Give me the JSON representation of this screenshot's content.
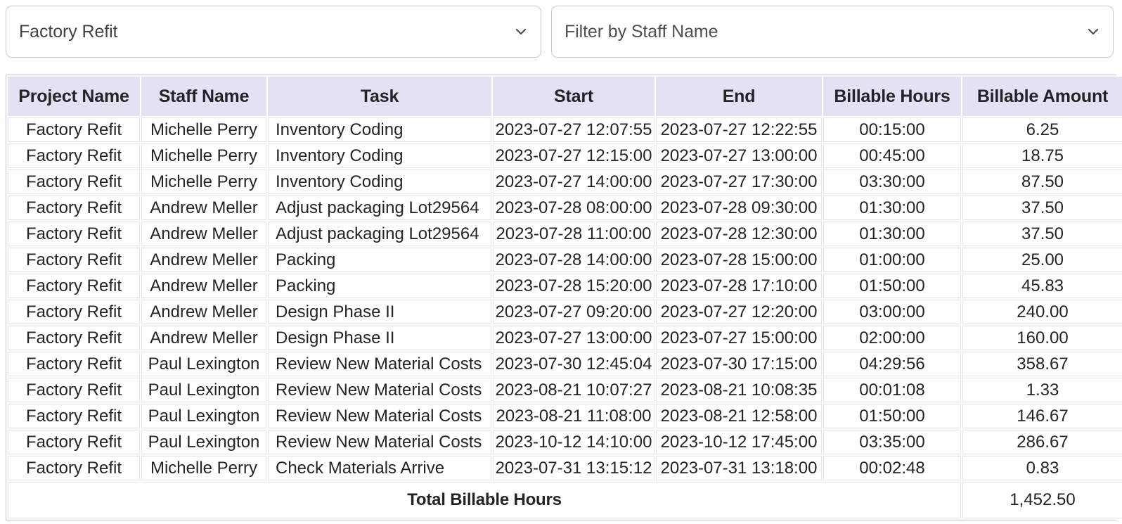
{
  "filters": {
    "project_select": {
      "value": "Factory Refit",
      "icon": "chevron-down-icon"
    },
    "staff_select": {
      "value": "Filter by Staff Name",
      "placeholder": "Filter by Staff Name",
      "icon": "chevron-down-icon"
    }
  },
  "table": {
    "columns": [
      "Project Name",
      "Staff Name",
      "Task",
      "Start",
      "End",
      "Billable Hours",
      "Billable Amount"
    ],
    "rows": [
      {
        "project": "Factory Refit",
        "staff": "Michelle Perry",
        "task": "Inventory Coding",
        "start": "2023-07-27 12:07:55",
        "end": "2023-07-27 12:22:55",
        "hours": "00:15:00",
        "amount": "6.25"
      },
      {
        "project": "Factory Refit",
        "staff": "Michelle Perry",
        "task": "Inventory Coding",
        "start": "2023-07-27 12:15:00",
        "end": "2023-07-27 13:00:00",
        "hours": "00:45:00",
        "amount": "18.75"
      },
      {
        "project": "Factory Refit",
        "staff": "Michelle Perry",
        "task": "Inventory Coding",
        "start": "2023-07-27 14:00:00",
        "end": "2023-07-27 17:30:00",
        "hours": "03:30:00",
        "amount": "87.50"
      },
      {
        "project": "Factory Refit",
        "staff": "Andrew Meller",
        "task": "Adjust packaging Lot29564",
        "start": "2023-07-28 08:00:00",
        "end": "2023-07-28 09:30:00",
        "hours": "01:30:00",
        "amount": "37.50"
      },
      {
        "project": "Factory Refit",
        "staff": "Andrew Meller",
        "task": "Adjust packaging Lot29564",
        "start": "2023-07-28 11:00:00",
        "end": "2023-07-28 12:30:00",
        "hours": "01:30:00",
        "amount": "37.50"
      },
      {
        "project": "Factory Refit",
        "staff": "Andrew Meller",
        "task": "Packing",
        "start": "2023-07-28 14:00:00",
        "end": "2023-07-28 15:00:00",
        "hours": "01:00:00",
        "amount": "25.00"
      },
      {
        "project": "Factory Refit",
        "staff": "Andrew Meller",
        "task": "Packing",
        "start": "2023-07-28 15:20:00",
        "end": "2023-07-28 17:10:00",
        "hours": "01:50:00",
        "amount": "45.83"
      },
      {
        "project": "Factory Refit",
        "staff": "Andrew Meller",
        "task": "Design Phase II",
        "start": "2023-07-27 09:20:00",
        "end": "2023-07-27 12:20:00",
        "hours": "03:00:00",
        "amount": "240.00"
      },
      {
        "project": "Factory Refit",
        "staff": "Andrew Meller",
        "task": "Design Phase II",
        "start": "2023-07-27 13:00:00",
        "end": "2023-07-27 15:00:00",
        "hours": "02:00:00",
        "amount": "160.00"
      },
      {
        "project": "Factory Refit",
        "staff": "Paul Lexington",
        "task": "Review New Material Costs",
        "start": "2023-07-30 12:45:04",
        "end": "2023-07-30 17:15:00",
        "hours": "04:29:56",
        "amount": "358.67"
      },
      {
        "project": "Factory Refit",
        "staff": "Paul Lexington",
        "task": "Review New Material Costs",
        "start": "2023-08-21 10:07:27",
        "end": "2023-08-21 10:08:35",
        "hours": "00:01:08",
        "amount": "1.33"
      },
      {
        "project": "Factory Refit",
        "staff": "Paul Lexington",
        "task": "Review New Material Costs",
        "start": "2023-08-21 11:08:00",
        "end": "2023-08-21 12:58:00",
        "hours": "01:50:00",
        "amount": "146.67"
      },
      {
        "project": "Factory Refit",
        "staff": "Paul Lexington",
        "task": "Review New Material Costs",
        "start": "2023-10-12 14:10:00",
        "end": "2023-10-12 17:45:00",
        "hours": "03:35:00",
        "amount": "286.67"
      },
      {
        "project": "Factory Refit",
        "staff": "Michelle Perry",
        "task": "Check Materials Arrive",
        "start": "2023-07-31 13:15:12",
        "end": "2023-07-31 13:18:00",
        "hours": "00:02:48",
        "amount": "0.83"
      }
    ],
    "footer": {
      "label": "Total Billable Hours",
      "value": "1,452.50"
    }
  },
  "colors": {
    "header_background": "#e2e2f3",
    "table_border": "#c3c3ef",
    "cell_border": "#e3e3e8",
    "text": "#212529"
  }
}
